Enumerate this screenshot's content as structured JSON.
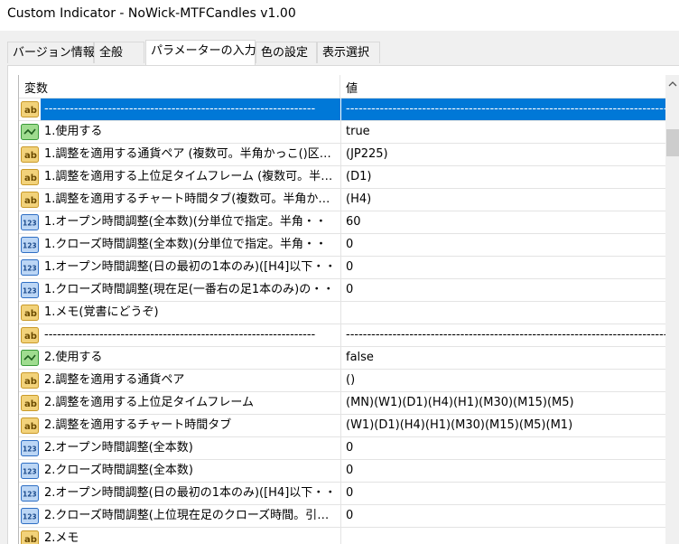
{
  "window": {
    "title": "Custom Indicator - NoWick-MTFCandles v1.00"
  },
  "tabs": [
    {
      "label": "バージョン情報"
    },
    {
      "label": "全般"
    },
    {
      "label": "パラメーターの入力"
    },
    {
      "label": "色の設定"
    },
    {
      "label": "表示選択"
    }
  ],
  "active_tab": "パラメーターの入力",
  "grid": {
    "header": {
      "variable": "変数",
      "value": "値"
    },
    "rows": [
      {
        "type": "ab",
        "name": "----------------------------------------------------------------",
        "value": "------------------------------------------------------------------------------------",
        "selected": true
      },
      {
        "type": "bool",
        "name": "1.使用する",
        "value": "true"
      },
      {
        "type": "ab",
        "name": "1.調整を適用する通貨ペア (複数可。半角かっこ()区・・",
        "value": "(JP225)"
      },
      {
        "type": "ab",
        "name": "1.調整を適用する上位足タイムフレーム (複数可。半・・",
        "value": "(D1)"
      },
      {
        "type": "ab",
        "name": "1.調整を適用するチャート時間タブ(複数可。半角かっ・・",
        "value": "(H4)"
      },
      {
        "type": "num",
        "name": "1.オープン時間調整(全本数)(分単位で指定。半角・・",
        "value": "60"
      },
      {
        "type": "num",
        "name": "1.クローズ時間調整(全本数)(分単位で指定。半角・・",
        "value": "0"
      },
      {
        "type": "num",
        "name": "1.オープン時間調整(日の最初の1本のみ)([H4]以下・・",
        "value": "0"
      },
      {
        "type": "num",
        "name": "1.クローズ時間調整(現在足(一番右の足1本のみ)の・・",
        "value": "0"
      },
      {
        "type": "ab",
        "name": "1.メモ(覚書にどうぞ)",
        "value": ""
      },
      {
        "type": "ab",
        "name": "----------------------------------------------------------------",
        "value": "------------------------------------------------------------------------------------"
      },
      {
        "type": "bool",
        "name": "2.使用する",
        "value": "false"
      },
      {
        "type": "ab",
        "name": "2.調整を適用する通貨ペア",
        "value": "()"
      },
      {
        "type": "ab",
        "name": "2.調整を適用する上位足タイムフレーム",
        "value": "(MN)(W1)(D1)(H4)(H1)(M30)(M15)(M5)"
      },
      {
        "type": "ab",
        "name": "2.調整を適用するチャート時間タブ",
        "value": "(W1)(D1)(H4)(H1)(M30)(M15)(M5)(M1)"
      },
      {
        "type": "num",
        "name": "2.オープン時間調整(全本数)",
        "value": "0"
      },
      {
        "type": "num",
        "name": "2.クローズ時間調整(全本数)",
        "value": "0"
      },
      {
        "type": "num",
        "name": "2.オープン時間調整(日の最初の1本のみ)([H4]以下・・",
        "value": "0"
      },
      {
        "type": "num",
        "name": "2.クローズ時間調整(上位現在足のクローズ時間。引く…",
        "value": "0"
      },
      {
        "type": "ab",
        "name": "2.メモ",
        "value": ""
      }
    ]
  },
  "icons": {
    "ab": "string-type-icon",
    "bool": "bool-type-icon",
    "num": "number-type-icon"
  },
  "colors": {
    "selection": "#0078d7",
    "ab_icon": "#e8b02a",
    "bool_icon": "#3a9a3a",
    "num_icon": "#2f6fc4"
  }
}
